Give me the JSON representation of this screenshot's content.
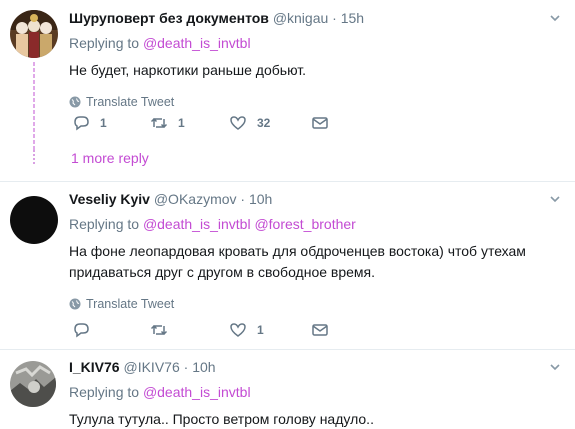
{
  "tweets": [
    {
      "name": "Шуруповерт без документов",
      "handle": "@knigau",
      "time": "15h",
      "replying_label": "Replying to",
      "mentions": [
        "@death_is_invtbl"
      ],
      "text": "Не будет, наркотики раньше добьют.",
      "translate": "Translate Tweet",
      "replies": "1",
      "retweets": "1",
      "likes": "32",
      "more_replies": "1 more reply"
    },
    {
      "name": "Veseliy Kyiv",
      "handle": "@OKazymov",
      "time": "10h",
      "replying_label": "Replying to",
      "mentions": [
        "@death_is_invtbl",
        "@forest_brother"
      ],
      "text": "На фоне леопардовая кровать для обдроченцев востока) чтоб утехам придаваться друг с другом в свободное время.",
      "translate": "Translate Tweet",
      "replies": "",
      "retweets": "",
      "likes": "1"
    },
    {
      "name": "I_KIV76",
      "handle": "@IKIV76",
      "time": "10h",
      "replying_label": "Replying to",
      "mentions": [
        "@death_is_invtbl"
      ],
      "text": "Тулула тутула.. Просто ветром голову надуло.."
    }
  ],
  "icons": {
    "chevron": "chevron-down-icon",
    "globe": "globe-icon",
    "reply": "reply-icon",
    "retweet": "retweet-icon",
    "like": "heart-icon",
    "dm": "envelope-icon"
  },
  "colors": {
    "accent": "#c34bd3",
    "muted": "#657786",
    "text": "#14171a"
  }
}
